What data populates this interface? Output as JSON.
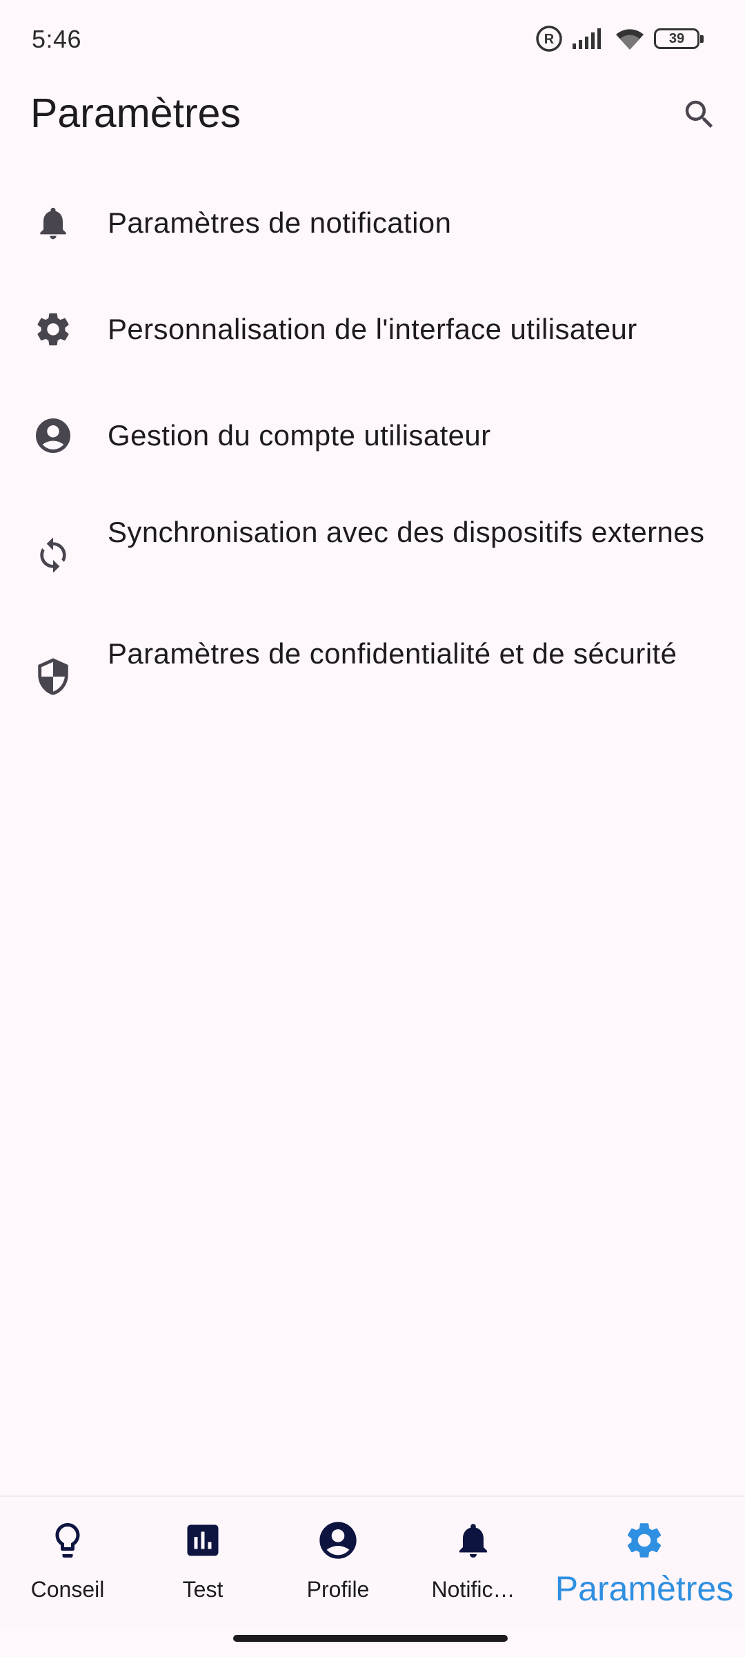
{
  "status_bar": {
    "time": "5:46",
    "battery_level": "39",
    "icons": [
      "registered-icon",
      "signal-icon",
      "wifi-icon",
      "battery-icon"
    ]
  },
  "app_bar": {
    "title": "Paramètres",
    "search_icon": "search-icon"
  },
  "settings": [
    {
      "icon": "bell-icon",
      "label": "Paramètres de notification"
    },
    {
      "icon": "gear-icon",
      "label": "Personnalisation de l'interface utilisateur"
    },
    {
      "icon": "account-circle-icon",
      "label": "Gestion du compte utilisateur"
    },
    {
      "icon": "sync-icon",
      "label": "Synchronisation avec des dispositifs externes"
    },
    {
      "icon": "shield-icon",
      "label": "Paramètres de confidentialité et de sécurité"
    }
  ],
  "bottom_nav": {
    "items": [
      {
        "icon": "lightbulb-icon",
        "label": "Conseil",
        "active": false
      },
      {
        "icon": "bar-chart-icon",
        "label": "Test",
        "active": false
      },
      {
        "icon": "account-circle-icon",
        "label": "Profile",
        "active": false
      },
      {
        "icon": "bell-icon",
        "label": "Notific…",
        "active": false
      },
      {
        "icon": "gear-icon",
        "label": "Paramètres",
        "active": true
      }
    ]
  },
  "colors": {
    "background": "#fef7fb",
    "text": "#1d1b20",
    "icon": "#49454f",
    "nav_icon": "#0d1440",
    "active": "#2f8fe0"
  }
}
